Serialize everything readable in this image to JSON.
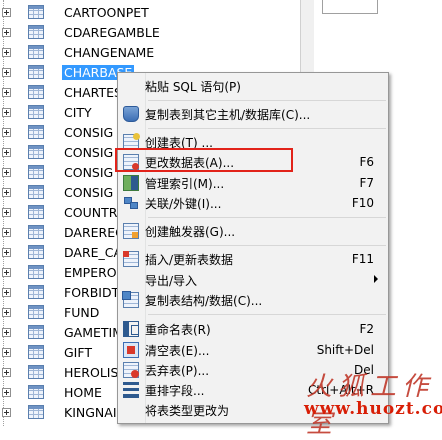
{
  "tree": {
    "items": [
      {
        "label": "CARTOONPET",
        "selected": false
      },
      {
        "label": "CDAREGAMBLE",
        "selected": false
      },
      {
        "label": "CHANGENAME",
        "selected": false
      },
      {
        "label": "CHARBASE",
        "selected": true
      },
      {
        "label": "CHARTES",
        "selected": false
      },
      {
        "label": "CITY",
        "selected": false
      },
      {
        "label": "CONSIG",
        "selected": false
      },
      {
        "label": "CONSIG",
        "selected": false
      },
      {
        "label": "CONSIG",
        "selected": false
      },
      {
        "label": "CONSIG",
        "selected": false
      },
      {
        "label": "COUNTR",
        "selected": false
      },
      {
        "label": "DAREREC",
        "selected": false
      },
      {
        "label": "DARE_CA",
        "selected": false
      },
      {
        "label": "EMPERO",
        "selected": false
      },
      {
        "label": "FORBIDT",
        "selected": false
      },
      {
        "label": "FUND",
        "selected": false
      },
      {
        "label": "GAMETIM",
        "selected": false
      },
      {
        "label": "GIFT",
        "selected": false
      },
      {
        "label": "HEROLIS",
        "selected": false
      },
      {
        "label": "HOME",
        "selected": false
      },
      {
        "label": "KINGNAI",
        "selected": false
      }
    ]
  },
  "context_menu": {
    "items": [
      {
        "label": "粘贴 SQL 语句(P)",
        "shortcut": "",
        "icon": "none",
        "submenu": false
      },
      {
        "label": "复制表到其它主机/数据库(C)...",
        "shortcut": "",
        "icon": "database-copy-icon",
        "submenu": false
      },
      {
        "label": "创建表(T) ...",
        "shortcut": "",
        "icon": "create-table-icon",
        "submenu": false
      },
      {
        "label": "更改数据表(A)...",
        "shortcut": "F6",
        "icon": "alter-table-icon",
        "submenu": false
      },
      {
        "label": "管理索引(M)...",
        "shortcut": "F7",
        "icon": "index-icon",
        "submenu": false
      },
      {
        "label": "关联/外键(I)...",
        "shortcut": "F10",
        "icon": "relation-icon",
        "submenu": false
      },
      {
        "label": "创建触发器(G)...",
        "shortcut": "",
        "icon": "trigger-icon",
        "submenu": false
      },
      {
        "label": "插入/更新表数据",
        "shortcut": "F11",
        "icon": "insert-data-icon",
        "submenu": false
      },
      {
        "label": "导出/导入",
        "shortcut": "",
        "icon": "none",
        "submenu": true
      },
      {
        "label": "复制表结构/数据(C)...",
        "shortcut": "",
        "icon": "copy-structure-icon",
        "submenu": false
      },
      {
        "label": "重命名表(R)",
        "shortcut": "F2",
        "icon": "rename-icon",
        "submenu": false
      },
      {
        "label": "清空表(E)...",
        "shortcut": "Shift+Del",
        "icon": "empty-table-icon",
        "submenu": false
      },
      {
        "label": "丢弃表(P)...",
        "shortcut": "Del",
        "icon": "drop-table-icon",
        "submenu": false
      },
      {
        "label": "重排字段...",
        "shortcut": "Ctrl+Alt+R",
        "icon": "reorder-icon",
        "submenu": false
      },
      {
        "label": "将表类型更改为",
        "shortcut": "",
        "icon": "none",
        "submenu": false
      }
    ]
  },
  "watermark": {
    "brand": "火狐工作室",
    "url": "www.huozt.com"
  },
  "colors": {
    "selection": "#3399ff",
    "highlight_box": "#e2231a",
    "watermark": "#d81e06"
  }
}
